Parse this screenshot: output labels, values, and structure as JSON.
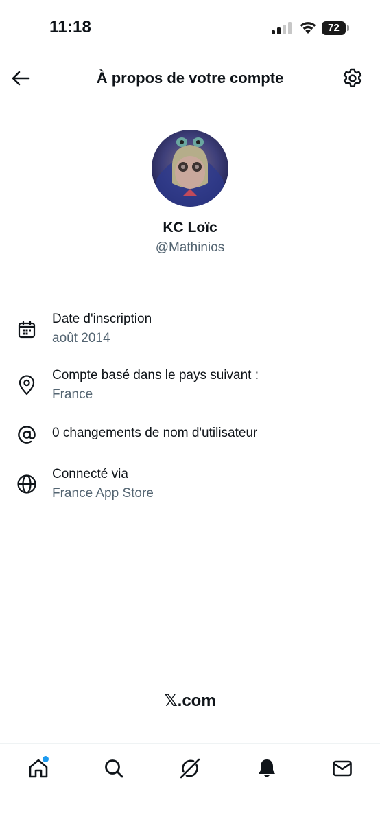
{
  "status_bar": {
    "time": "11:18",
    "battery": "72"
  },
  "header": {
    "title": "À propos de votre compte"
  },
  "profile": {
    "name": "KC Loïc",
    "handle": "@Mathinios"
  },
  "info": {
    "joined": {
      "label": "Date d'inscription",
      "value": "août 2014",
      "icon": "calendar-icon"
    },
    "country": {
      "label": "Compte basé dans le pays suivant :",
      "value": "France",
      "icon": "location-pin-icon"
    },
    "username": {
      "label": "0 changements de nom d'utilisateur",
      "icon": "at-sign-icon"
    },
    "connected": {
      "label": "Connecté via",
      "value": "France App Store",
      "icon": "globe-icon"
    }
  },
  "footer": {
    "brand": "𝕏.com"
  },
  "nav": {
    "items": [
      "home-icon",
      "search-icon",
      "grok-icon",
      "notifications-icon",
      "messages-icon"
    ],
    "home_has_badge": true
  },
  "colors": {
    "text": "#0f1419",
    "secondary": "#536471",
    "accent": "#1d9bf0"
  }
}
